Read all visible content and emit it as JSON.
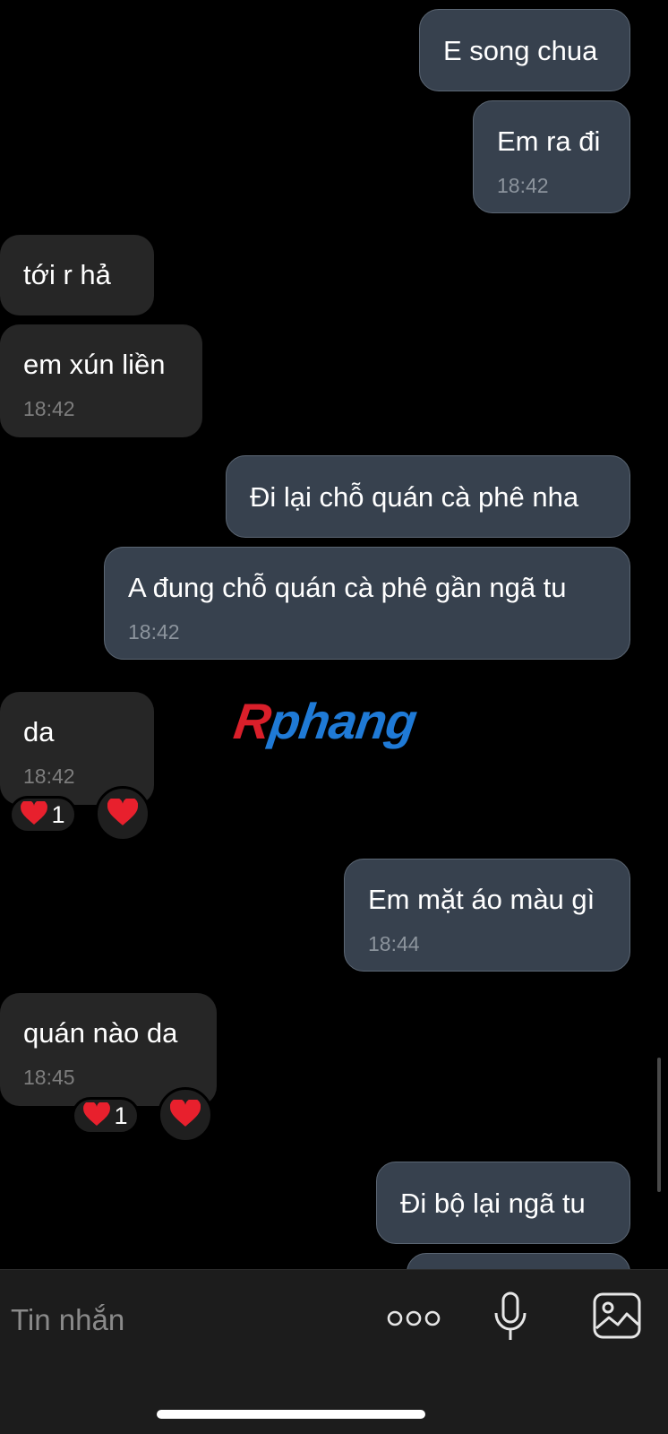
{
  "messages": [
    {
      "text": "E song chua",
      "time": ""
    },
    {
      "text": "Em ra đi",
      "time": "18:42"
    },
    {
      "text": "tới r hả",
      "time": ""
    },
    {
      "text": "em xún liền",
      "time": "18:42"
    },
    {
      "text": "Đi lại chỗ quán cà phê nha",
      "time": ""
    },
    {
      "text": "A đung chỗ quán cà phê gần ngã tu",
      "time": "18:42"
    },
    {
      "text": "da",
      "time": "18:42",
      "reaction": {
        "emoji": "❤️",
        "count": "1"
      }
    },
    {
      "text": "Em mặt áo màu gì",
      "time": "18:44"
    },
    {
      "text": "quán nào da",
      "time": "18:45",
      "reaction": {
        "emoji": "❤️",
        "count": "1"
      }
    },
    {
      "text": "Đi bộ lại ngã tu",
      "time": ""
    }
  ],
  "watermark": {
    "first": "R",
    "rest": "phang"
  },
  "composer": {
    "placeholder": "Tin nhắn"
  },
  "icons": {
    "more": "more-dots-icon",
    "mic": "microphone-icon",
    "gallery": "photo-gallery-icon",
    "heart": "heart-icon"
  },
  "colors": {
    "background": "#000000",
    "outgoing_bubble": "#37414e",
    "incoming_bubble": "#262626",
    "reaction_heart": "#e8202d"
  }
}
